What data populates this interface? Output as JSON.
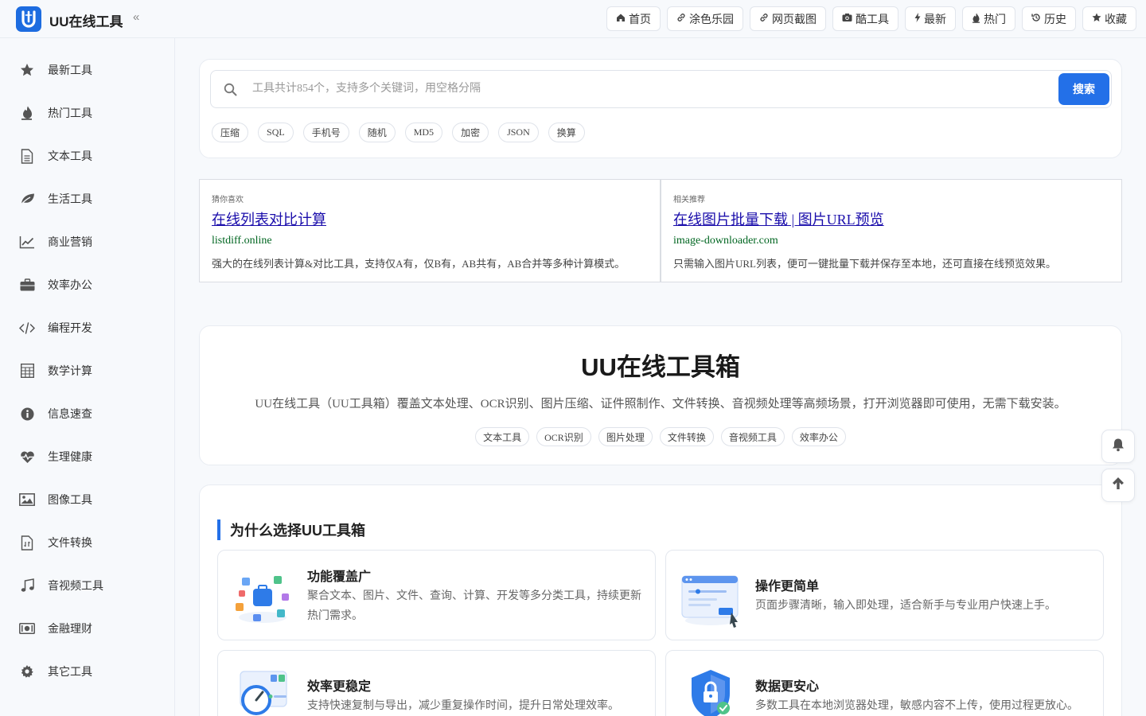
{
  "app": {
    "title": "UU在线工具"
  },
  "header": {
    "collapse_icon": "«",
    "nav": [
      {
        "icon": "home-icon",
        "glyph": "⌂",
        "label": "首页"
      },
      {
        "icon": "link-icon",
        "glyph": "🔗",
        "label": "涂色乐园"
      },
      {
        "icon": "link-icon",
        "glyph": "🔗",
        "label": "网页截图"
      },
      {
        "icon": "camera-icon",
        "glyph": "📷",
        "label": "酷工具"
      },
      {
        "icon": "bolt-icon",
        "glyph": "ϟ",
        "label": "最新"
      },
      {
        "icon": "fire-icon",
        "glyph": "🔥",
        "label": "热门"
      },
      {
        "icon": "history-icon",
        "glyph": "↺",
        "label": "历史"
      },
      {
        "icon": "star-icon",
        "glyph": "★",
        "label": "收藏"
      }
    ]
  },
  "sidebar": {
    "items": [
      {
        "icon": "star-icon",
        "label": "最新工具"
      },
      {
        "icon": "fire-icon",
        "label": "热门工具"
      },
      {
        "icon": "document-icon",
        "label": "文本工具"
      },
      {
        "icon": "leaf-icon",
        "label": "生活工具"
      },
      {
        "icon": "chart-line-icon",
        "label": "商业营销"
      },
      {
        "icon": "briefcase-icon",
        "label": "效率办公"
      },
      {
        "icon": "code-icon",
        "label": "编程开发"
      },
      {
        "icon": "calculator-icon",
        "label": "数学计算"
      },
      {
        "icon": "info-icon",
        "label": "信息速查"
      },
      {
        "icon": "heartbeat-icon",
        "label": "生理健康"
      },
      {
        "icon": "image-icon",
        "label": "图像工具"
      },
      {
        "icon": "file-convert-icon",
        "label": "文件转换"
      },
      {
        "icon": "music-icon",
        "label": "音视频工具"
      },
      {
        "icon": "money-icon",
        "label": "金融理财"
      },
      {
        "icon": "gear-icon",
        "label": "其它工具"
      }
    ]
  },
  "search": {
    "placeholder": "工具共计854个，支持多个关键词，用空格分隔",
    "button_label": "搜索",
    "hot_tags": [
      "压缩",
      "SQL",
      "手机号",
      "随机",
      "MD5",
      "加密",
      "JSON",
      "换算"
    ]
  },
  "ads": [
    {
      "label": "猜你喜欢",
      "title": "在线列表对比计算",
      "url": "listdiff.online",
      "desc": "强大的在线列表计算&对比工具，支持仅A有，仅B有，AB共有，AB合并等多种计算模式。"
    },
    {
      "label": "相关推荐",
      "title": "在线图片批量下载 | 图片URL预览",
      "url": "image-downloader.com",
      "desc": "只需输入图片URL列表，便可一键批量下载并保存至本地，还可直接在线预览效果。"
    }
  ],
  "intro": {
    "title": "UU在线工具箱",
    "desc": "UU在线工具（UU工具箱）覆盖文本处理、OCR识别、图片压缩、证件照制作、文件转换、音视频处理等高频场景，打开浏览器即可使用，无需下载安装。",
    "tags": [
      "文本工具",
      "OCR识别",
      "图片处理",
      "文件转换",
      "音视频工具",
      "效率办公"
    ]
  },
  "why": {
    "title": "为什么选择UU工具箱",
    "features": [
      {
        "title": "功能覆盖广",
        "desc": "聚合文本、图片、文件、查询、计算、开发等多分类工具，持续更新热门需求。"
      },
      {
        "title": "操作更简单",
        "desc": "页面步骤清晰，输入即处理，适合新手与专业用户快速上手。"
      },
      {
        "title": "效率更稳定",
        "desc": "支持快速复制与导出，减少重复操作时间，提升日常处理效率。"
      },
      {
        "title": "数据更安心",
        "desc": "多数工具在本地浏览器处理，敏感内容不上传，使用过程更放心。"
      }
    ]
  },
  "floating": [
    {
      "icon": "bell-icon"
    },
    {
      "icon": "arrow-up-icon"
    }
  ],
  "colors": {
    "accent": "#2370e8",
    "ad_title": "#1a0dab",
    "ad_url": "#006621"
  }
}
